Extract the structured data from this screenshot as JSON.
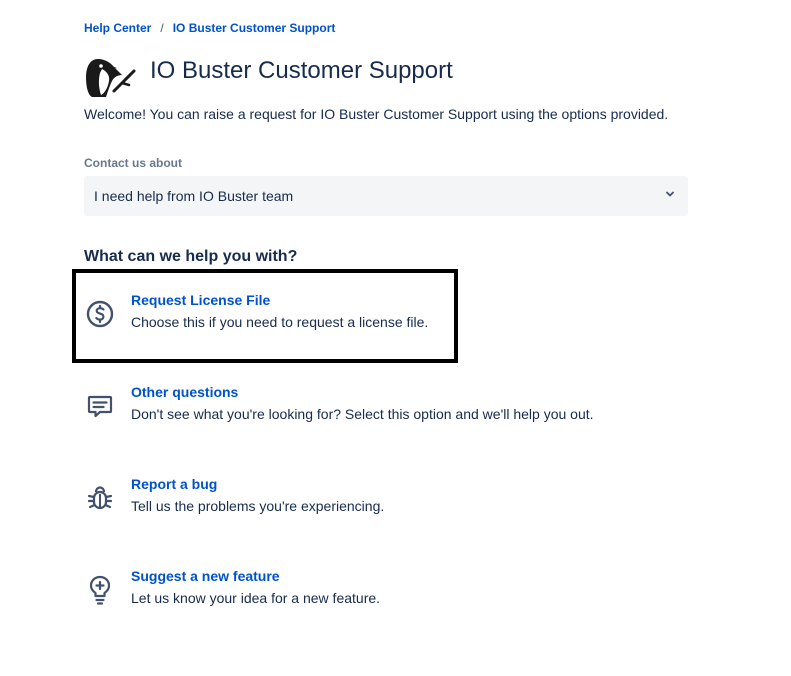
{
  "breadcrumb": {
    "items": [
      "Help Center",
      "IO Buster Customer Support"
    ],
    "separator": "/"
  },
  "portal": {
    "title": "IO Buster Customer Support",
    "logo_icon": "penguin-logo-icon",
    "welcome": "Welcome! You can raise a request for IO Buster Customer Support using the options provided."
  },
  "contact": {
    "label": "Contact us about",
    "selected": "I need help from IO Buster team"
  },
  "help": {
    "heading": "What can we help you with?",
    "options": [
      {
        "title": "Request License File",
        "description": "Choose this if you need to request a license file.",
        "icon": "dollar-circle-icon",
        "highlighted": true
      },
      {
        "title": "Other questions",
        "description": "Don't see what you're looking for? Select this option and we'll help you out.",
        "icon": "comment-icon"
      },
      {
        "title": "Report a bug",
        "description": "Tell us the problems you're experiencing.",
        "icon": "bug-icon"
      },
      {
        "title": "Suggest a new feature",
        "description": "Let us know your idea for a new feature.",
        "icon": "lightbulb-icon"
      }
    ]
  },
  "colors": {
    "link": "#0052cc",
    "text": "#172b4d",
    "muted": "#6b778c",
    "select_bg": "#f4f5f7",
    "icon": "#42526e",
    "highlight": "#000000"
  }
}
